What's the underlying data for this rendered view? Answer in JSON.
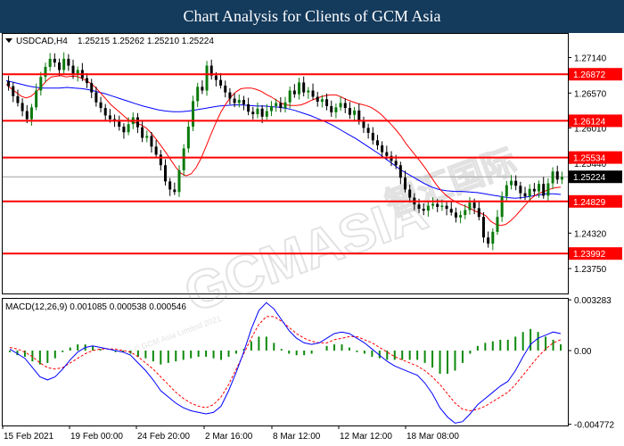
{
  "page_title": "Chart Analysis for Clients of GCM Asia",
  "chart_data": [
    {
      "type": "candlestick",
      "symbol_label": "USDCAD,H4",
      "ohlc_label": "1.25215 1.25262 1.25210 1.25224",
      "ylim": [
        1.2335,
        1.2752
      ],
      "y_ticks": [
        1.2714,
        1.2657,
        1.2601,
        1.2544,
        1.2488,
        1.2432,
        1.2375
      ],
      "y_tick_labels": [
        "1.27140",
        "1.26570",
        "1.26010",
        "1.25440",
        "1.24880",
        "1.24320",
        "1.23750"
      ],
      "current_price": 1.25224,
      "current_price_label": "1.25224",
      "levels": [
        1.26872,
        1.26124,
        1.25534,
        1.24829,
        1.23992
      ],
      "level_labels": [
        "1.26872",
        "1.26124",
        "1.25534",
        "1.24829",
        "1.23992"
      ],
      "level_color": "#ff0000",
      "bull_color": "#0b7a0b",
      "bear_color": "#000000",
      "ma_fast_color": "#ff0000",
      "ma_slow_color": "#0000ff",
      "close": [
        1.2668,
        1.2652,
        1.2641,
        1.2628,
        1.2615,
        1.2634,
        1.2661,
        1.2683,
        1.2699,
        1.2712,
        1.2706,
        1.2694,
        1.2712,
        1.2701,
        1.2686,
        1.2694,
        1.2681,
        1.2673,
        1.2658,
        1.2642,
        1.2633,
        1.2621,
        1.2615,
        1.2611,
        1.2603,
        1.2594,
        1.2607,
        1.2618,
        1.2602,
        1.2585,
        1.2588,
        1.2571,
        1.2558,
        1.2541,
        1.2515,
        1.2502,
        1.2498,
        1.2533,
        1.2568,
        1.2603,
        1.2644,
        1.2667,
        1.2661,
        1.2701,
        1.2685,
        1.2678,
        1.2669,
        1.2658,
        1.2648,
        1.2641,
        1.2646,
        1.2639,
        1.2627,
        1.2623,
        1.2632,
        1.2619,
        1.2628,
        1.2636,
        1.2641,
        1.2633,
        1.2642,
        1.2661,
        1.2655,
        1.2674,
        1.2658,
        1.2661,
        1.2651,
        1.2643,
        1.2647,
        1.2636,
        1.2626,
        1.2634,
        1.2641,
        1.2633,
        1.2622,
        1.2629,
        1.2611,
        1.2601,
        1.2593,
        1.2581,
        1.2573,
        1.2562,
        1.2556,
        1.2548,
        1.2541,
        1.2521,
        1.2502,
        1.2489,
        1.2478,
        1.2471,
        1.2468,
        1.2476,
        1.2479,
        1.2474,
        1.2476,
        1.2471,
        1.2465,
        1.2457,
        1.2461,
        1.2469,
        1.2481,
        1.2472,
        1.2458,
        1.2425,
        1.2415,
        1.2434,
        1.2458,
        1.2491,
        1.2509,
        1.2516,
        1.2508,
        1.2496,
        1.2491,
        1.2503,
        1.2499,
        1.2511,
        1.2492,
        1.2512,
        1.2531,
        1.2518,
        1.2522
      ],
      "ma_fast": [
        1.2671,
        1.2664,
        1.2658,
        1.2652,
        1.2649,
        1.2652,
        1.2659,
        1.2667,
        1.2676,
        1.2683,
        1.2684,
        1.2685,
        1.2683,
        1.2684,
        1.2684,
        1.2681,
        1.2677,
        1.2672,
        1.2665,
        1.2656,
        1.2647,
        1.2638,
        1.2631,
        1.2624,
        1.2617,
        1.2611,
        1.2609,
        1.2606,
        1.2601,
        1.2593,
        1.2583,
        1.2572,
        1.2561,
        1.2549,
        1.2537,
        1.2528,
        1.2524,
        1.2527,
        1.2537,
        1.2552,
        1.2571,
        1.2591,
        1.261,
        1.2627,
        1.264,
        1.2651,
        1.2659,
        1.2664,
        1.2665,
        1.2665,
        1.2663,
        1.266,
        1.2655,
        1.2651,
        1.2646,
        1.2641,
        1.2638,
        1.2637,
        1.2637,
        1.2638,
        1.2641,
        1.2645,
        1.2648,
        1.2651,
        1.2653,
        1.2654,
        1.2654,
        1.2651,
        1.2647,
        1.2644,
        1.2641,
        1.2639,
        1.2637,
        1.2634,
        1.2629,
        1.2623,
        1.2615,
        1.2607,
        1.2598,
        1.2588,
        1.2576,
        1.2566,
        1.2556,
        1.2546,
        1.2535,
        1.2523,
        1.2511,
        1.2501,
        1.2493,
        1.2487,
        1.2482,
        1.2478,
        1.2475,
        1.2471,
        1.2467,
        1.2464,
        1.246,
        1.2451,
        1.2446,
        1.2444,
        1.2446,
        1.2452,
        1.246,
        1.2469,
        1.2478,
        1.2487,
        1.2493,
        1.2497,
        1.25,
        1.2503,
        1.2505,
        1.2506
      ],
      "ma_slow": [
        1.2677,
        1.2674,
        1.2671,
        1.2668,
        1.2666,
        1.2665,
        1.2665,
        1.2665,
        1.2666,
        1.2665,
        1.2664,
        1.2662,
        1.2659,
        1.2656,
        1.2652,
        1.2648,
        1.2644,
        1.264,
        1.2636,
        1.2633,
        1.263,
        1.2628,
        1.2627,
        1.2627,
        1.2628,
        1.263,
        1.2632,
        1.2634,
        1.2636,
        1.2637,
        1.2638,
        1.2638,
        1.2637,
        1.2636,
        1.2636,
        1.2635,
        1.2634,
        1.2632,
        1.2629,
        1.2625,
        1.2621,
        1.2616,
        1.2611,
        1.2605,
        1.2598,
        1.2591,
        1.2584,
        1.2576,
        1.2568,
        1.256,
        1.2551,
        1.2542,
        1.2533,
        1.2526,
        1.2519,
        1.2512,
        1.2506,
        1.2502,
        1.25,
        1.2499,
        1.2499,
        1.2498,
        1.2497,
        1.2495,
        1.2493,
        1.2491,
        1.2489,
        1.2488,
        1.2489,
        1.2491,
        1.2493,
        1.2495,
        1.2495,
        1.2494
      ]
    },
    {
      "type": "macd",
      "label": "MACD(12,26,9) 0.001085 0.000538 0.000546",
      "ylim": [
        -0.00485,
        0.00335
      ],
      "y_tick_labels": [
        "0.003283",
        "0.00",
        "-0.004772"
      ],
      "y_ticks": [
        0.003283,
        0,
        -0.004772
      ],
      "hist_color": "#0b8a0b",
      "macd_color": "#0000ff",
      "signal_color": "#ff0000",
      "macd": [
        0.0001,
        -0.0002,
        -0.0005,
        -0.0011,
        -0.0017,
        -0.0019,
        -0.0017,
        -0.0012,
        -0.0006,
        -0.0001,
        0.0002,
        0.0003,
        0.0002,
        0.0001,
        0.0,
        -0.0001,
        -0.0003,
        -0.0008,
        -0.0013,
        -0.0019,
        -0.0026,
        -0.003,
        -0.0034,
        -0.0037,
        -0.0039,
        -0.004,
        -0.0041,
        -0.004,
        -0.0036,
        -0.0026,
        -0.0014,
        -0.0001,
        0.0014,
        0.0026,
        0.0031,
        0.0027,
        0.002,
        0.0013,
        0.0008,
        0.0005,
        0.0004,
        0.0005,
        0.0008,
        0.0011,
        0.0012,
        0.0011,
        0.0008,
        0.0005,
        0.0001,
        -0.0003,
        -0.0007,
        -0.001,
        -0.0012,
        -0.0014,
        -0.0016,
        -0.0021,
        -0.0028,
        -0.0037,
        -0.0043,
        -0.0047,
        -0.0046,
        -0.0041,
        -0.0035,
        -0.0031,
        -0.0027,
        -0.0023,
        -0.002,
        -0.0013,
        -0.0004,
        0.0004,
        0.0008,
        0.001,
        0.0012,
        0.0011
      ],
      "signal": [
        0.0002,
        0.0001,
        -0.0001,
        -0.0004,
        -0.0008,
        -0.0011,
        -0.0012,
        -0.0011,
        -0.0008,
        -0.0005,
        -0.0002,
        0.0,
        0.0001,
        0.0001,
        0.0001,
        0.0,
        -0.0001,
        -0.0004,
        -0.0008,
        -0.0012,
        -0.0017,
        -0.0022,
        -0.0027,
        -0.0031,
        -0.0034,
        -0.0036,
        -0.0037,
        -0.0035,
        -0.003,
        -0.0022,
        -0.0012,
        -0.0002,
        0.0008,
        0.0017,
        0.0022,
        0.0022,
        0.0019,
        0.0015,
        0.0011,
        0.0008,
        0.0006,
        0.0005,
        0.0005,
        0.0007,
        0.0008,
        0.0009,
        0.0009,
        0.0007,
        0.0005,
        0.0002,
        -0.0001,
        -0.0004,
        -0.0006,
        -0.0008,
        -0.001,
        -0.0013,
        -0.0017,
        -0.0022,
        -0.0028,
        -0.0034,
        -0.0038,
        -0.0039,
        -0.0038,
        -0.0036,
        -0.0033,
        -0.003,
        -0.0027,
        -0.0022,
        -0.0016,
        -0.001,
        -0.0004,
        0.0001,
        0.0005,
        0.0007
      ]
    }
  ],
  "x_axis_labels": [
    "15 Feb 2021",
    "19 Feb 00:00",
    "24 Feb 20:00",
    "2 Mar 16:00",
    "8 Mar 12:00",
    "12 Mar 12:00",
    "18 Mar 08:00"
  ],
  "watermark_text": "GCMASIA",
  "watermark_sub": "© GCM Asia Limited 2021",
  "watermark_cn": "智汇国际"
}
